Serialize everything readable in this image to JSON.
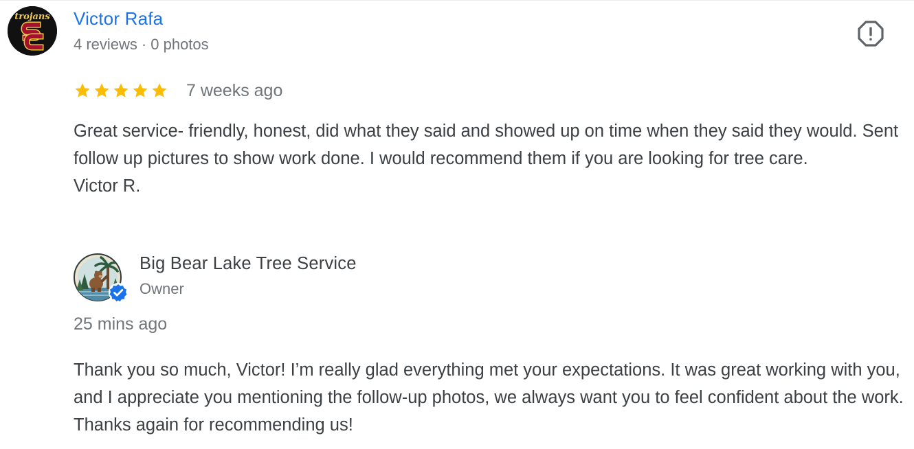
{
  "review": {
    "reviewer": {
      "name": "Victor Rafa",
      "reviews_count": "4 reviews",
      "separator": "·",
      "photos_count": "0 photos",
      "avatar_icon": "usc-trojans-sc-logo",
      "avatar_text": "trojans"
    },
    "report_icon": "exclamation-octagon-icon",
    "rating": 5,
    "max_rating": 5,
    "star_color": "#fbbc04",
    "date": "7 weeks ago",
    "text": "Great service- friendly, honest, did what they said and showed up on time when they said they would. Sent follow up pictures to show work done. I would recommend them if you are looking for tree care.\nVictor R."
  },
  "owner_response": {
    "name": "Big Bear Lake Tree Service",
    "role": "Owner",
    "avatar_icon": "bear-tree-logo",
    "verified_icon": "verified-check-badge-icon",
    "date": "25 mins ago",
    "text": "Thank you so much, Victor! I’m really glad everything met your expectations. It was great working with you, and I appreciate you mentioning the follow-up photos, we always want you to feel confident about the work. Thanks again for recommending us!"
  },
  "colors": {
    "link_blue": "#1a73e8",
    "secondary_text": "#70757a",
    "primary_text": "#3c4043",
    "verified_blue": "#1a73e8"
  }
}
